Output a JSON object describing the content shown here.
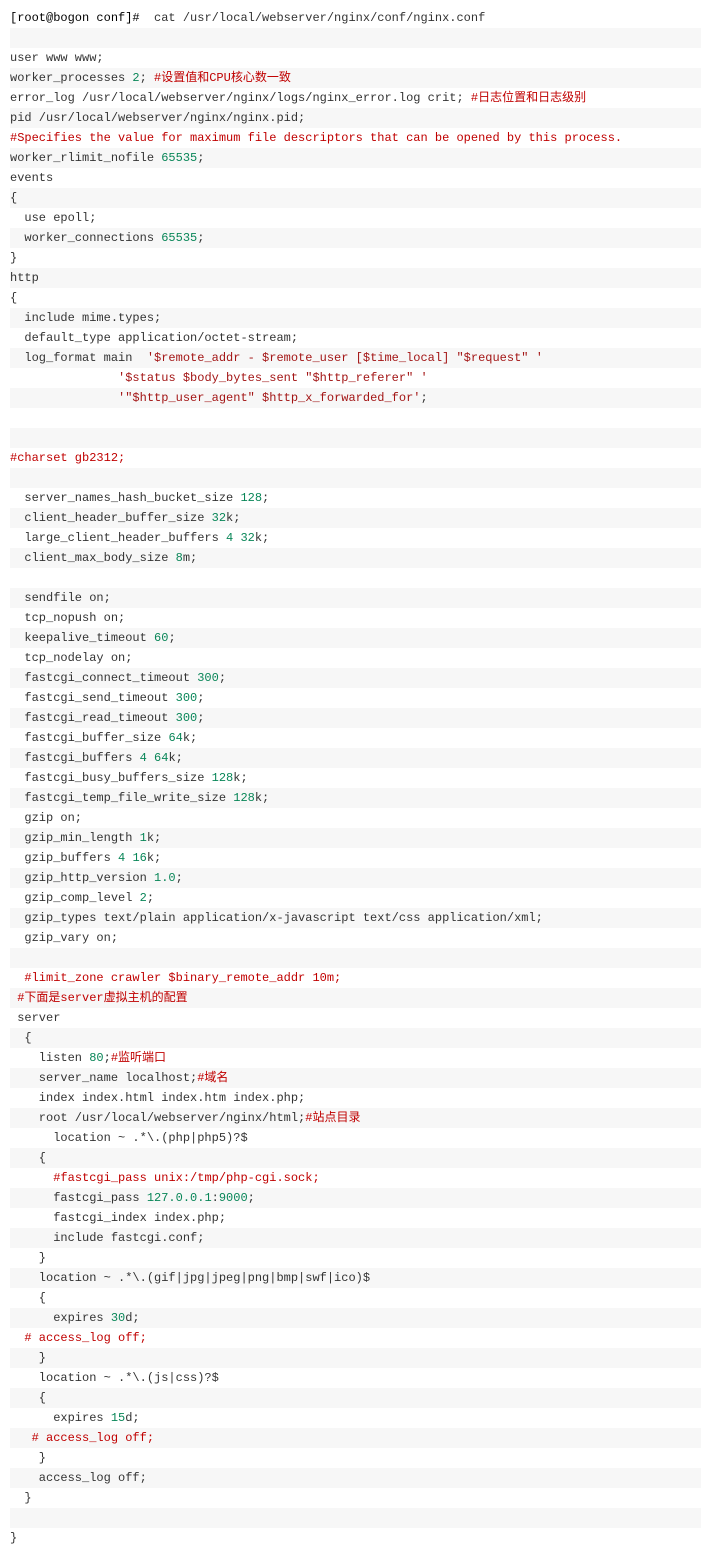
{
  "lines": [
    {
      "segments": [
        {
          "cls": "prompt",
          "t": "[root@bogon conf]#  "
        },
        {
          "cls": "cmd",
          "t": "cat /usr/local/webserver/nginx/conf/nginx.conf"
        }
      ]
    },
    {
      "segments": [
        {
          "cls": "txt",
          "t": ""
        }
      ]
    },
    {
      "segments": [
        {
          "cls": "txt",
          "t": "user www www;"
        }
      ]
    },
    {
      "segments": [
        {
          "cls": "txt",
          "t": "worker_processes "
        },
        {
          "cls": "num",
          "t": "2"
        },
        {
          "cls": "txt",
          "t": "; "
        },
        {
          "cls": "comment-cn",
          "t": "#设置值和CPU核心数一致"
        }
      ]
    },
    {
      "segments": [
        {
          "cls": "txt",
          "t": "error_log /usr/local/webserver/nginx/logs/nginx_error.log crit; "
        },
        {
          "cls": "comment-cn",
          "t": "#日志位置和日志级别"
        }
      ]
    },
    {
      "segments": [
        {
          "cls": "txt",
          "t": "pid /usr/local/webserver/nginx/nginx.pid;"
        }
      ]
    },
    {
      "segments": [
        {
          "cls": "comment-hash",
          "t": "#Specifies the value for maximum file descriptors that can be opened by this process."
        }
      ]
    },
    {
      "segments": [
        {
          "cls": "txt",
          "t": "worker_rlimit_nofile "
        },
        {
          "cls": "num",
          "t": "65535"
        },
        {
          "cls": "txt",
          "t": ";"
        }
      ]
    },
    {
      "segments": [
        {
          "cls": "txt",
          "t": "events"
        }
      ]
    },
    {
      "segments": [
        {
          "cls": "txt",
          "t": "{"
        }
      ]
    },
    {
      "segments": [
        {
          "cls": "txt",
          "t": "  use epoll;"
        }
      ]
    },
    {
      "segments": [
        {
          "cls": "txt",
          "t": "  worker_connections "
        },
        {
          "cls": "num",
          "t": "65535"
        },
        {
          "cls": "txt",
          "t": ";"
        }
      ]
    },
    {
      "segments": [
        {
          "cls": "txt",
          "t": "}"
        }
      ]
    },
    {
      "segments": [
        {
          "cls": "txt",
          "t": "http"
        }
      ]
    },
    {
      "segments": [
        {
          "cls": "txt",
          "t": "{"
        }
      ]
    },
    {
      "segments": [
        {
          "cls": "txt",
          "t": "  include mime.types;"
        }
      ]
    },
    {
      "segments": [
        {
          "cls": "txt",
          "t": "  default_type application/octet-stream;"
        }
      ]
    },
    {
      "segments": [
        {
          "cls": "txt",
          "t": "  log_format main  "
        },
        {
          "cls": "str",
          "t": "'$remote_addr - $remote_user [$time_local] \"$request\" '"
        }
      ]
    },
    {
      "segments": [
        {
          "cls": "txt",
          "t": "               "
        },
        {
          "cls": "str",
          "t": "'$status $body_bytes_sent \"$http_referer\" '"
        }
      ]
    },
    {
      "segments": [
        {
          "cls": "txt",
          "t": "               "
        },
        {
          "cls": "str",
          "t": "'\"$http_user_agent\" $http_x_forwarded_for'"
        },
        {
          "cls": "txt",
          "t": ";"
        }
      ]
    },
    {
      "segments": [
        {
          "cls": "txt",
          "t": " "
        }
      ]
    },
    {
      "segments": [
        {
          "cls": "txt",
          "t": "  "
        }
      ]
    },
    {
      "segments": [
        {
          "cls": "comment-hash",
          "t": "#charset gb2312;"
        }
      ]
    },
    {
      "segments": [
        {
          "cls": "txt",
          "t": "     "
        }
      ]
    },
    {
      "segments": [
        {
          "cls": "txt",
          "t": "  server_names_hash_bucket_size "
        },
        {
          "cls": "num",
          "t": "128"
        },
        {
          "cls": "txt",
          "t": ";"
        }
      ]
    },
    {
      "segments": [
        {
          "cls": "txt",
          "t": "  client_header_buffer_size "
        },
        {
          "cls": "num",
          "t": "32"
        },
        {
          "cls": "txt",
          "t": "k;"
        }
      ]
    },
    {
      "segments": [
        {
          "cls": "txt",
          "t": "  large_client_header_buffers "
        },
        {
          "cls": "num",
          "t": "4"
        },
        {
          "cls": "txt",
          "t": " "
        },
        {
          "cls": "num",
          "t": "32"
        },
        {
          "cls": "txt",
          "t": "k;"
        }
      ]
    },
    {
      "segments": [
        {
          "cls": "txt",
          "t": "  client_max_body_size "
        },
        {
          "cls": "num",
          "t": "8"
        },
        {
          "cls": "txt",
          "t": "m;"
        }
      ]
    },
    {
      "segments": [
        {
          "cls": "txt",
          "t": "     "
        }
      ]
    },
    {
      "segments": [
        {
          "cls": "txt",
          "t": "  sendfile on;"
        }
      ]
    },
    {
      "segments": [
        {
          "cls": "txt",
          "t": "  tcp_nopush on;"
        }
      ]
    },
    {
      "segments": [
        {
          "cls": "txt",
          "t": "  keepalive_timeout "
        },
        {
          "cls": "num",
          "t": "60"
        },
        {
          "cls": "txt",
          "t": ";"
        }
      ]
    },
    {
      "segments": [
        {
          "cls": "txt",
          "t": "  tcp_nodelay on;"
        }
      ]
    },
    {
      "segments": [
        {
          "cls": "txt",
          "t": "  fastcgi_connect_timeout "
        },
        {
          "cls": "num",
          "t": "300"
        },
        {
          "cls": "txt",
          "t": ";"
        }
      ]
    },
    {
      "segments": [
        {
          "cls": "txt",
          "t": "  fastcgi_send_timeout "
        },
        {
          "cls": "num",
          "t": "300"
        },
        {
          "cls": "txt",
          "t": ";"
        }
      ]
    },
    {
      "segments": [
        {
          "cls": "txt",
          "t": "  fastcgi_read_timeout "
        },
        {
          "cls": "num",
          "t": "300"
        },
        {
          "cls": "txt",
          "t": ";"
        }
      ]
    },
    {
      "segments": [
        {
          "cls": "txt",
          "t": "  fastcgi_buffer_size "
        },
        {
          "cls": "num",
          "t": "64"
        },
        {
          "cls": "txt",
          "t": "k;"
        }
      ]
    },
    {
      "segments": [
        {
          "cls": "txt",
          "t": "  fastcgi_buffers "
        },
        {
          "cls": "num",
          "t": "4"
        },
        {
          "cls": "txt",
          "t": " "
        },
        {
          "cls": "num",
          "t": "64"
        },
        {
          "cls": "txt",
          "t": "k;"
        }
      ]
    },
    {
      "segments": [
        {
          "cls": "txt",
          "t": "  fastcgi_busy_buffers_size "
        },
        {
          "cls": "num",
          "t": "128"
        },
        {
          "cls": "txt",
          "t": "k;"
        }
      ]
    },
    {
      "segments": [
        {
          "cls": "txt",
          "t": "  fastcgi_temp_file_write_size "
        },
        {
          "cls": "num",
          "t": "128"
        },
        {
          "cls": "txt",
          "t": "k;"
        }
      ]
    },
    {
      "segments": [
        {
          "cls": "txt",
          "t": "  gzip on; "
        }
      ]
    },
    {
      "segments": [
        {
          "cls": "txt",
          "t": "  gzip_min_length "
        },
        {
          "cls": "num",
          "t": "1"
        },
        {
          "cls": "txt",
          "t": "k;"
        }
      ]
    },
    {
      "segments": [
        {
          "cls": "txt",
          "t": "  gzip_buffers "
        },
        {
          "cls": "num",
          "t": "4"
        },
        {
          "cls": "txt",
          "t": " "
        },
        {
          "cls": "num",
          "t": "16"
        },
        {
          "cls": "txt",
          "t": "k;"
        }
      ]
    },
    {
      "segments": [
        {
          "cls": "txt",
          "t": "  gzip_http_version "
        },
        {
          "cls": "num",
          "t": "1.0"
        },
        {
          "cls": "txt",
          "t": ";"
        }
      ]
    },
    {
      "segments": [
        {
          "cls": "txt",
          "t": "  gzip_comp_level "
        },
        {
          "cls": "num",
          "t": "2"
        },
        {
          "cls": "txt",
          "t": ";"
        }
      ]
    },
    {
      "segments": [
        {
          "cls": "txt",
          "t": "  gzip_types text/plain application/x-javascript text/css application/xml;"
        }
      ]
    },
    {
      "segments": [
        {
          "cls": "txt",
          "t": "  gzip_vary on;"
        }
      ]
    },
    {
      "segments": [
        {
          "cls": "txt",
          "t": " "
        }
      ]
    },
    {
      "segments": [
        {
          "cls": "txt",
          "t": "  "
        },
        {
          "cls": "comment-hash",
          "t": "#limit_zone crawler $binary_remote_addr 10m;"
        }
      ]
    },
    {
      "segments": [
        {
          "cls": "txt",
          "t": " "
        },
        {
          "cls": "comment-cn",
          "t": "#下面是server虚拟主机的配置"
        }
      ]
    },
    {
      "segments": [
        {
          "cls": "txt",
          "t": " server"
        }
      ]
    },
    {
      "segments": [
        {
          "cls": "txt",
          "t": "  {"
        }
      ]
    },
    {
      "segments": [
        {
          "cls": "txt",
          "t": "    listen "
        },
        {
          "cls": "num",
          "t": "80"
        },
        {
          "cls": "txt",
          "t": ";"
        },
        {
          "cls": "comment-cn",
          "t": "#监听端口"
        }
      ]
    },
    {
      "segments": [
        {
          "cls": "txt",
          "t": "    server_name localhost;"
        },
        {
          "cls": "comment-cn",
          "t": "#域名"
        }
      ]
    },
    {
      "segments": [
        {
          "cls": "txt",
          "t": "    index index.html index.htm index.php;"
        }
      ]
    },
    {
      "segments": [
        {
          "cls": "txt",
          "t": "    root /usr/local/webserver/nginx/html;"
        },
        {
          "cls": "comment-cn",
          "t": "#站点目录"
        }
      ]
    },
    {
      "segments": [
        {
          "cls": "txt",
          "t": "      location ~ .*\\.(php|php5)?$"
        }
      ]
    },
    {
      "segments": [
        {
          "cls": "txt",
          "t": "    {"
        }
      ]
    },
    {
      "segments": [
        {
          "cls": "txt",
          "t": "      "
        },
        {
          "cls": "comment-hash",
          "t": "#fastcgi_pass unix:/tmp/php-cgi.sock;"
        }
      ]
    },
    {
      "segments": [
        {
          "cls": "txt",
          "t": "      fastcgi_pass "
        },
        {
          "cls": "num",
          "t": "127.0.0.1"
        },
        {
          "cls": "txt",
          "t": ":"
        },
        {
          "cls": "num",
          "t": "9000"
        },
        {
          "cls": "txt",
          "t": ";"
        }
      ]
    },
    {
      "segments": [
        {
          "cls": "txt",
          "t": "      fastcgi_index index.php;"
        }
      ]
    },
    {
      "segments": [
        {
          "cls": "txt",
          "t": "      include fastcgi.conf;"
        }
      ]
    },
    {
      "segments": [
        {
          "cls": "txt",
          "t": "    }"
        }
      ]
    },
    {
      "segments": [
        {
          "cls": "txt",
          "t": "    location ~ .*\\.(gif|jpg|jpeg|png|bmp|swf|ico)$"
        }
      ]
    },
    {
      "segments": [
        {
          "cls": "txt",
          "t": "    {"
        }
      ]
    },
    {
      "segments": [
        {
          "cls": "txt",
          "t": "      expires "
        },
        {
          "cls": "num",
          "t": "30"
        },
        {
          "cls": "txt",
          "t": "d;"
        }
      ]
    },
    {
      "segments": [
        {
          "cls": "txt",
          "t": "  "
        },
        {
          "cls": "comment-hash",
          "t": "# access_log off;"
        }
      ]
    },
    {
      "segments": [
        {
          "cls": "txt",
          "t": "    }"
        }
      ]
    },
    {
      "segments": [
        {
          "cls": "txt",
          "t": "    location ~ .*\\.(js|css)?$"
        }
      ]
    },
    {
      "segments": [
        {
          "cls": "txt",
          "t": "    {"
        }
      ]
    },
    {
      "segments": [
        {
          "cls": "txt",
          "t": "      expires "
        },
        {
          "cls": "num",
          "t": "15"
        },
        {
          "cls": "txt",
          "t": "d;"
        }
      ]
    },
    {
      "segments": [
        {
          "cls": "txt",
          "t": "   "
        },
        {
          "cls": "comment-hash",
          "t": "# access_log off;"
        }
      ]
    },
    {
      "segments": [
        {
          "cls": "txt",
          "t": "    }"
        }
      ]
    },
    {
      "segments": [
        {
          "cls": "txt",
          "t": "    access_log off;"
        }
      ]
    },
    {
      "segments": [
        {
          "cls": "txt",
          "t": "  }"
        }
      ]
    },
    {
      "segments": [
        {
          "cls": "txt",
          "t": " "
        }
      ]
    },
    {
      "segments": [
        {
          "cls": "txt",
          "t": "}"
        }
      ]
    }
  ]
}
